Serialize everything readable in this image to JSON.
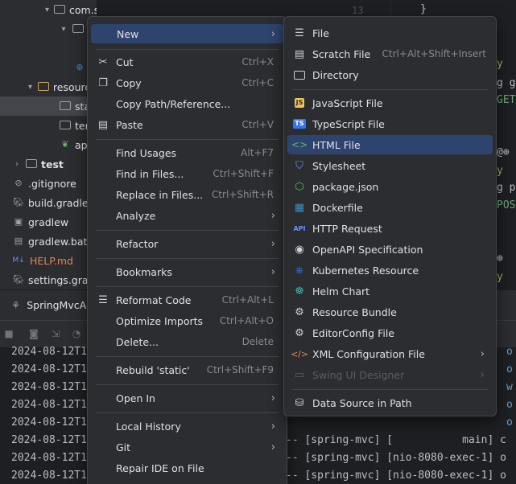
{
  "project_tree": {
    "items": [
      {
        "label": "com.sparta.springmvc",
        "top": 0
      },
      {
        "label": "resources"
      },
      {
        "label": "static"
      },
      {
        "label": "templates"
      },
      {
        "label": "application.properties"
      },
      {
        "label": "test"
      },
      {
        "label": ".gitignore"
      },
      {
        "label": "build.gradle"
      },
      {
        "label": "gradlew"
      },
      {
        "label": "gradlew.bat"
      },
      {
        "label": "HELP.md"
      },
      {
        "label": "settings.gradle"
      }
    ],
    "visible": {
      "package": "com.sparta.springmvc",
      "resources": "resource",
      "static": "stati",
      "templates": "tem",
      "app": "app",
      "test": "test",
      "gitignore": ".gitignore",
      "build": "build.gradle",
      "gradlew": "gradlew",
      "gradlew_bat": "gradlew.bat",
      "help": "HELP.md",
      "help_badge": "M↓",
      "settings": "settings.gradle"
    }
  },
  "editor": {
    "line_number": "13",
    "brace": "}",
    "fragments": [
      "y",
      "g g",
      "GET",
      "y",
      "g p",
      "POS",
      "y"
    ]
  },
  "run": {
    "tab_label": "SpringMvcA"
  },
  "console": {
    "timestamps": [
      "2024-08-12T1",
      "2024-08-12T1",
      "2024-08-12T1",
      "2024-08-12T1",
      "2024-08-12T1",
      "2024-08-12T1",
      "2024-08-12T1",
      "2024-08-12T1"
    ],
    "right_lines": [
      {
        "text": "-- [spring-mvc] [           main] c",
        "row": 5
      },
      {
        "text": "-- [spring-mvc] [nio-8080-exec-1] o",
        "row": 6
      },
      {
        "text": "-- [spring-mvc] [nio-8080-exec-1] o",
        "row": 7
      },
      {
        "text": "-- [spring-mvc] [nio-8080-exec-1] o",
        "row": 8
      }
    ],
    "right_edge_chars": [
      "o",
      "o",
      "w",
      "o",
      "o"
    ]
  },
  "context_menu": {
    "items": [
      {
        "label": "New",
        "shortcut": "",
        "submenu": true,
        "icon": "",
        "active": true
      },
      {
        "label": "Cut",
        "shortcut": "Ctrl+X",
        "icon": "scissors-icon"
      },
      {
        "label": "Copy",
        "shortcut": "Ctrl+C",
        "icon": "copy-icon"
      },
      {
        "label": "Copy Path/Reference...",
        "shortcut": ""
      },
      {
        "label": "Paste",
        "shortcut": "Ctrl+V",
        "icon": "clipboard-icon"
      },
      {
        "label": "Find Usages",
        "shortcut": "Alt+F7"
      },
      {
        "label": "Find in Files...",
        "shortcut": "Ctrl+Shift+F"
      },
      {
        "label": "Replace in Files...",
        "shortcut": "Ctrl+Shift+R"
      },
      {
        "label": "Analyze",
        "shortcut": "",
        "submenu": true
      },
      {
        "label": "Refactor",
        "shortcut": "",
        "submenu": true
      },
      {
        "label": "Bookmarks",
        "shortcut": "",
        "submenu": true
      },
      {
        "label": "Reformat Code",
        "shortcut": "Ctrl+Alt+L",
        "icon": "reformat-icon"
      },
      {
        "label": "Optimize Imports",
        "shortcut": "Ctrl+Alt+O"
      },
      {
        "label": "Delete...",
        "shortcut": "Delete"
      },
      {
        "label": "Rebuild 'static'",
        "shortcut": "Ctrl+Shift+F9"
      },
      {
        "label": "Open In",
        "shortcut": "",
        "submenu": true
      },
      {
        "label": "Local History",
        "shortcut": "",
        "submenu": true
      },
      {
        "label": "Git",
        "shortcut": "",
        "submenu": true
      },
      {
        "label": "Repair IDE on File",
        "shortcut": ""
      }
    ]
  },
  "new_submenu": {
    "items": [
      {
        "label": "File",
        "icon": "file-lines-icon"
      },
      {
        "label": "Scratch File",
        "shortcut": "Ctrl+Alt+Shift+Insert",
        "icon": "scratch-file-icon"
      },
      {
        "label": "Directory",
        "icon": "folder-icon"
      },
      {
        "label": "JavaScript File",
        "icon": "javascript-icon",
        "badge": "JS"
      },
      {
        "label": "TypeScript File",
        "icon": "typescript-icon",
        "badge": "TS"
      },
      {
        "label": "HTML File",
        "icon": "html-icon",
        "active": true
      },
      {
        "label": "Stylesheet",
        "icon": "css-icon"
      },
      {
        "label": "package.json",
        "icon": "nodejs-icon"
      },
      {
        "label": "Dockerfile",
        "icon": "docker-icon"
      },
      {
        "label": "HTTP Request",
        "icon": "api-icon",
        "badge": "API"
      },
      {
        "label": "OpenAPI Specification",
        "icon": "openapi-icon"
      },
      {
        "label": "Kubernetes Resource",
        "icon": "kubernetes-icon"
      },
      {
        "label": "Helm Chart",
        "icon": "helm-icon"
      },
      {
        "label": "Resource Bundle",
        "icon": "gear-icon"
      },
      {
        "label": "EditorConfig File",
        "icon": "gear-icon"
      },
      {
        "label": "XML Configuration File",
        "icon": "xml-icon",
        "submenu": true
      },
      {
        "label": "Swing UI Designer",
        "icon": "form-icon",
        "submenu": true,
        "disabled": true
      },
      {
        "label": "Data Source in Path",
        "icon": "database-icon"
      }
    ]
  },
  "colors": {
    "menu_bg": "#2b2d30",
    "active_bg": "#2e436e",
    "html_active_bg": "#2e436e",
    "js_badge": "#f2c55c",
    "ts_badge": "#3574f0",
    "css_icon": "#6d8fff",
    "xml_icon": "#e08855",
    "green": "#5fb865"
  }
}
